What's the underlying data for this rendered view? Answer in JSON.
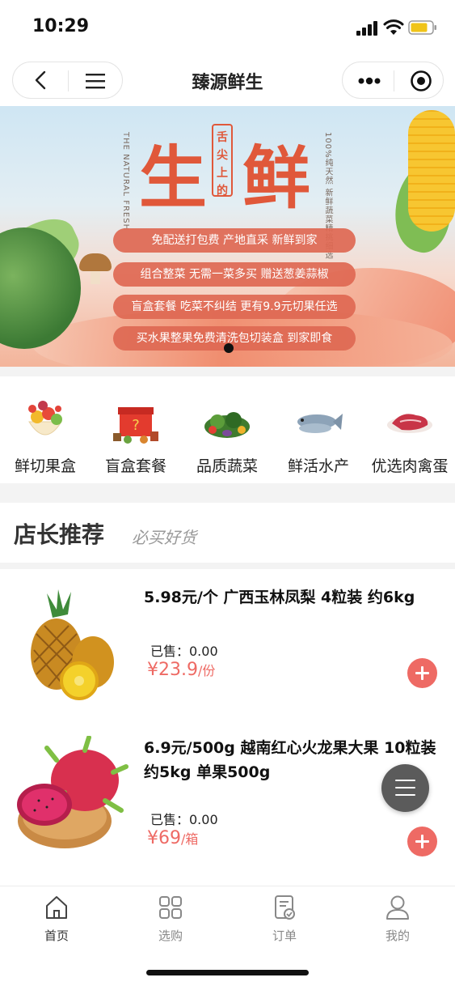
{
  "status_bar": {
    "time": "10:29"
  },
  "nav": {
    "title": "臻源鲜生"
  },
  "banner": {
    "headline_chars": [
      "生",
      "鲜"
    ],
    "seal_text": "舌尖上的",
    "side_text_left": "THE NATURAL FRESH",
    "side_text_right": "100%纯天然 新鲜蔬菜精挑细选",
    "promo_lines": [
      "免配送打包费 产地直采 新鲜到家",
      "组合整菜 无需一菜多买 赠送葱姜蒜椒",
      "盲盒套餐 吃菜不纠结 更有9.9元切果任选",
      "买水果整果免费清洗包切装盒 到家即食"
    ]
  },
  "categories": [
    {
      "label": "鲜切果盒",
      "icon": "fruit-box-icon"
    },
    {
      "label": "盲盒套餐",
      "icon": "gift-box-icon"
    },
    {
      "label": "品质蔬菜",
      "icon": "vegetable-icon"
    },
    {
      "label": "鲜活水产",
      "icon": "fish-icon"
    },
    {
      "label": "优选肉禽蛋",
      "icon": "meat-icon"
    }
  ],
  "recommend": {
    "title": "店长推荐",
    "subtitle": "必买好货"
  },
  "products": [
    {
      "name": "5.98元/个 广西玉林凤梨 4粒装 约6kg",
      "sold": "已售：0.00",
      "price": "¥23.9",
      "unit": "/份",
      "image": "pineapple-image"
    },
    {
      "name": "6.9元/500g 越南红心火龙果大果 10粒装 约5kg 单果500g",
      "sold": "已售：0.00",
      "price": "¥69",
      "unit": "/箱",
      "image": "dragon-fruit-image"
    }
  ],
  "tabbar": {
    "items": [
      {
        "label": "首页",
        "icon": "home-icon",
        "active": true
      },
      {
        "label": "选购",
        "icon": "grid-icon",
        "active": false
      },
      {
        "label": "订单",
        "icon": "order-icon",
        "active": false
      },
      {
        "label": "我的",
        "icon": "user-icon",
        "active": false
      }
    ]
  },
  "colors": {
    "accent": "#ee6a64",
    "banner_text": "#e0583a",
    "pill": "#de6852"
  }
}
